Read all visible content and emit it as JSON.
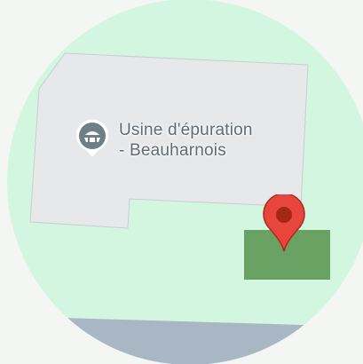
{
  "map": {
    "poi": {
      "name_line1": "Usine d'épuration",
      "name_line2": "- Beauharnois",
      "icon": "water-treatment-plant-icon"
    },
    "marker": {
      "icon": "location-pin-icon"
    },
    "colors": {
      "outside_circle": "#f4f6f3",
      "park_background": "#d3f6e1",
      "facility_area": "#e6e8ea",
      "facility_border": "#c9cdd2",
      "green_area": "#6aa264",
      "water": "#a9b7c4",
      "pin_red": "#e8453c",
      "pin_dark": "#a52714",
      "poi_icon_bg": "#6e7f88",
      "label_text": "#5f6b73"
    }
  }
}
